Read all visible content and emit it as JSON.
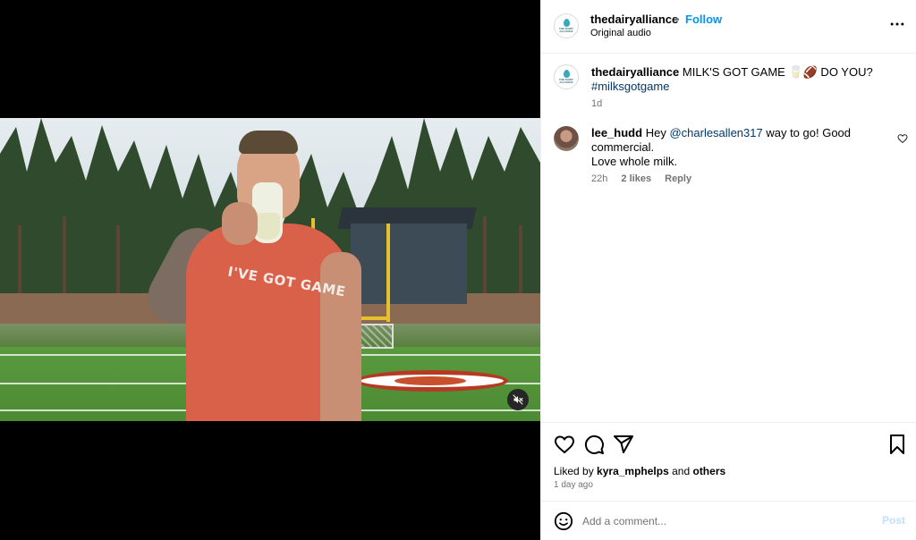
{
  "post": {
    "username": "thedairyalliance",
    "separator": "•",
    "follow_label": "Follow",
    "audio": "Original audio",
    "logo_text": "THE DAIRY ALLIANCE",
    "more_icon": "more-icon"
  },
  "video": {
    "shirt_text": "I'VE GOT GAME",
    "mute_icon": "muted-speaker-icon"
  },
  "caption": {
    "username": "thedairyalliance",
    "text": "MILK'S GOT GAME 🥛🏈 DO YOU?",
    "hashtag": "#milksgotgame",
    "age": "1d"
  },
  "comments": [
    {
      "username": "lee_hudd",
      "text_before": "Hey",
      "mention": "@charlesallen317",
      "text_after": "way to go! Good commercial.",
      "text_line2": "Love whole milk.",
      "age": "22h",
      "likes": "2 likes",
      "reply": "Reply"
    }
  ],
  "actions": {
    "liked_by_prefix": "Liked by",
    "liked_by_user": "kyra_mphelps",
    "liked_by_and": "and",
    "liked_by_others": "others",
    "time": "1 day ago"
  },
  "add_comment": {
    "placeholder": "Add a comment...",
    "post_label": "Post"
  },
  "colors": {
    "accent": "#0095f6",
    "link": "#00376b",
    "muted": "#737373",
    "post_disabled": "#c0dffd"
  }
}
